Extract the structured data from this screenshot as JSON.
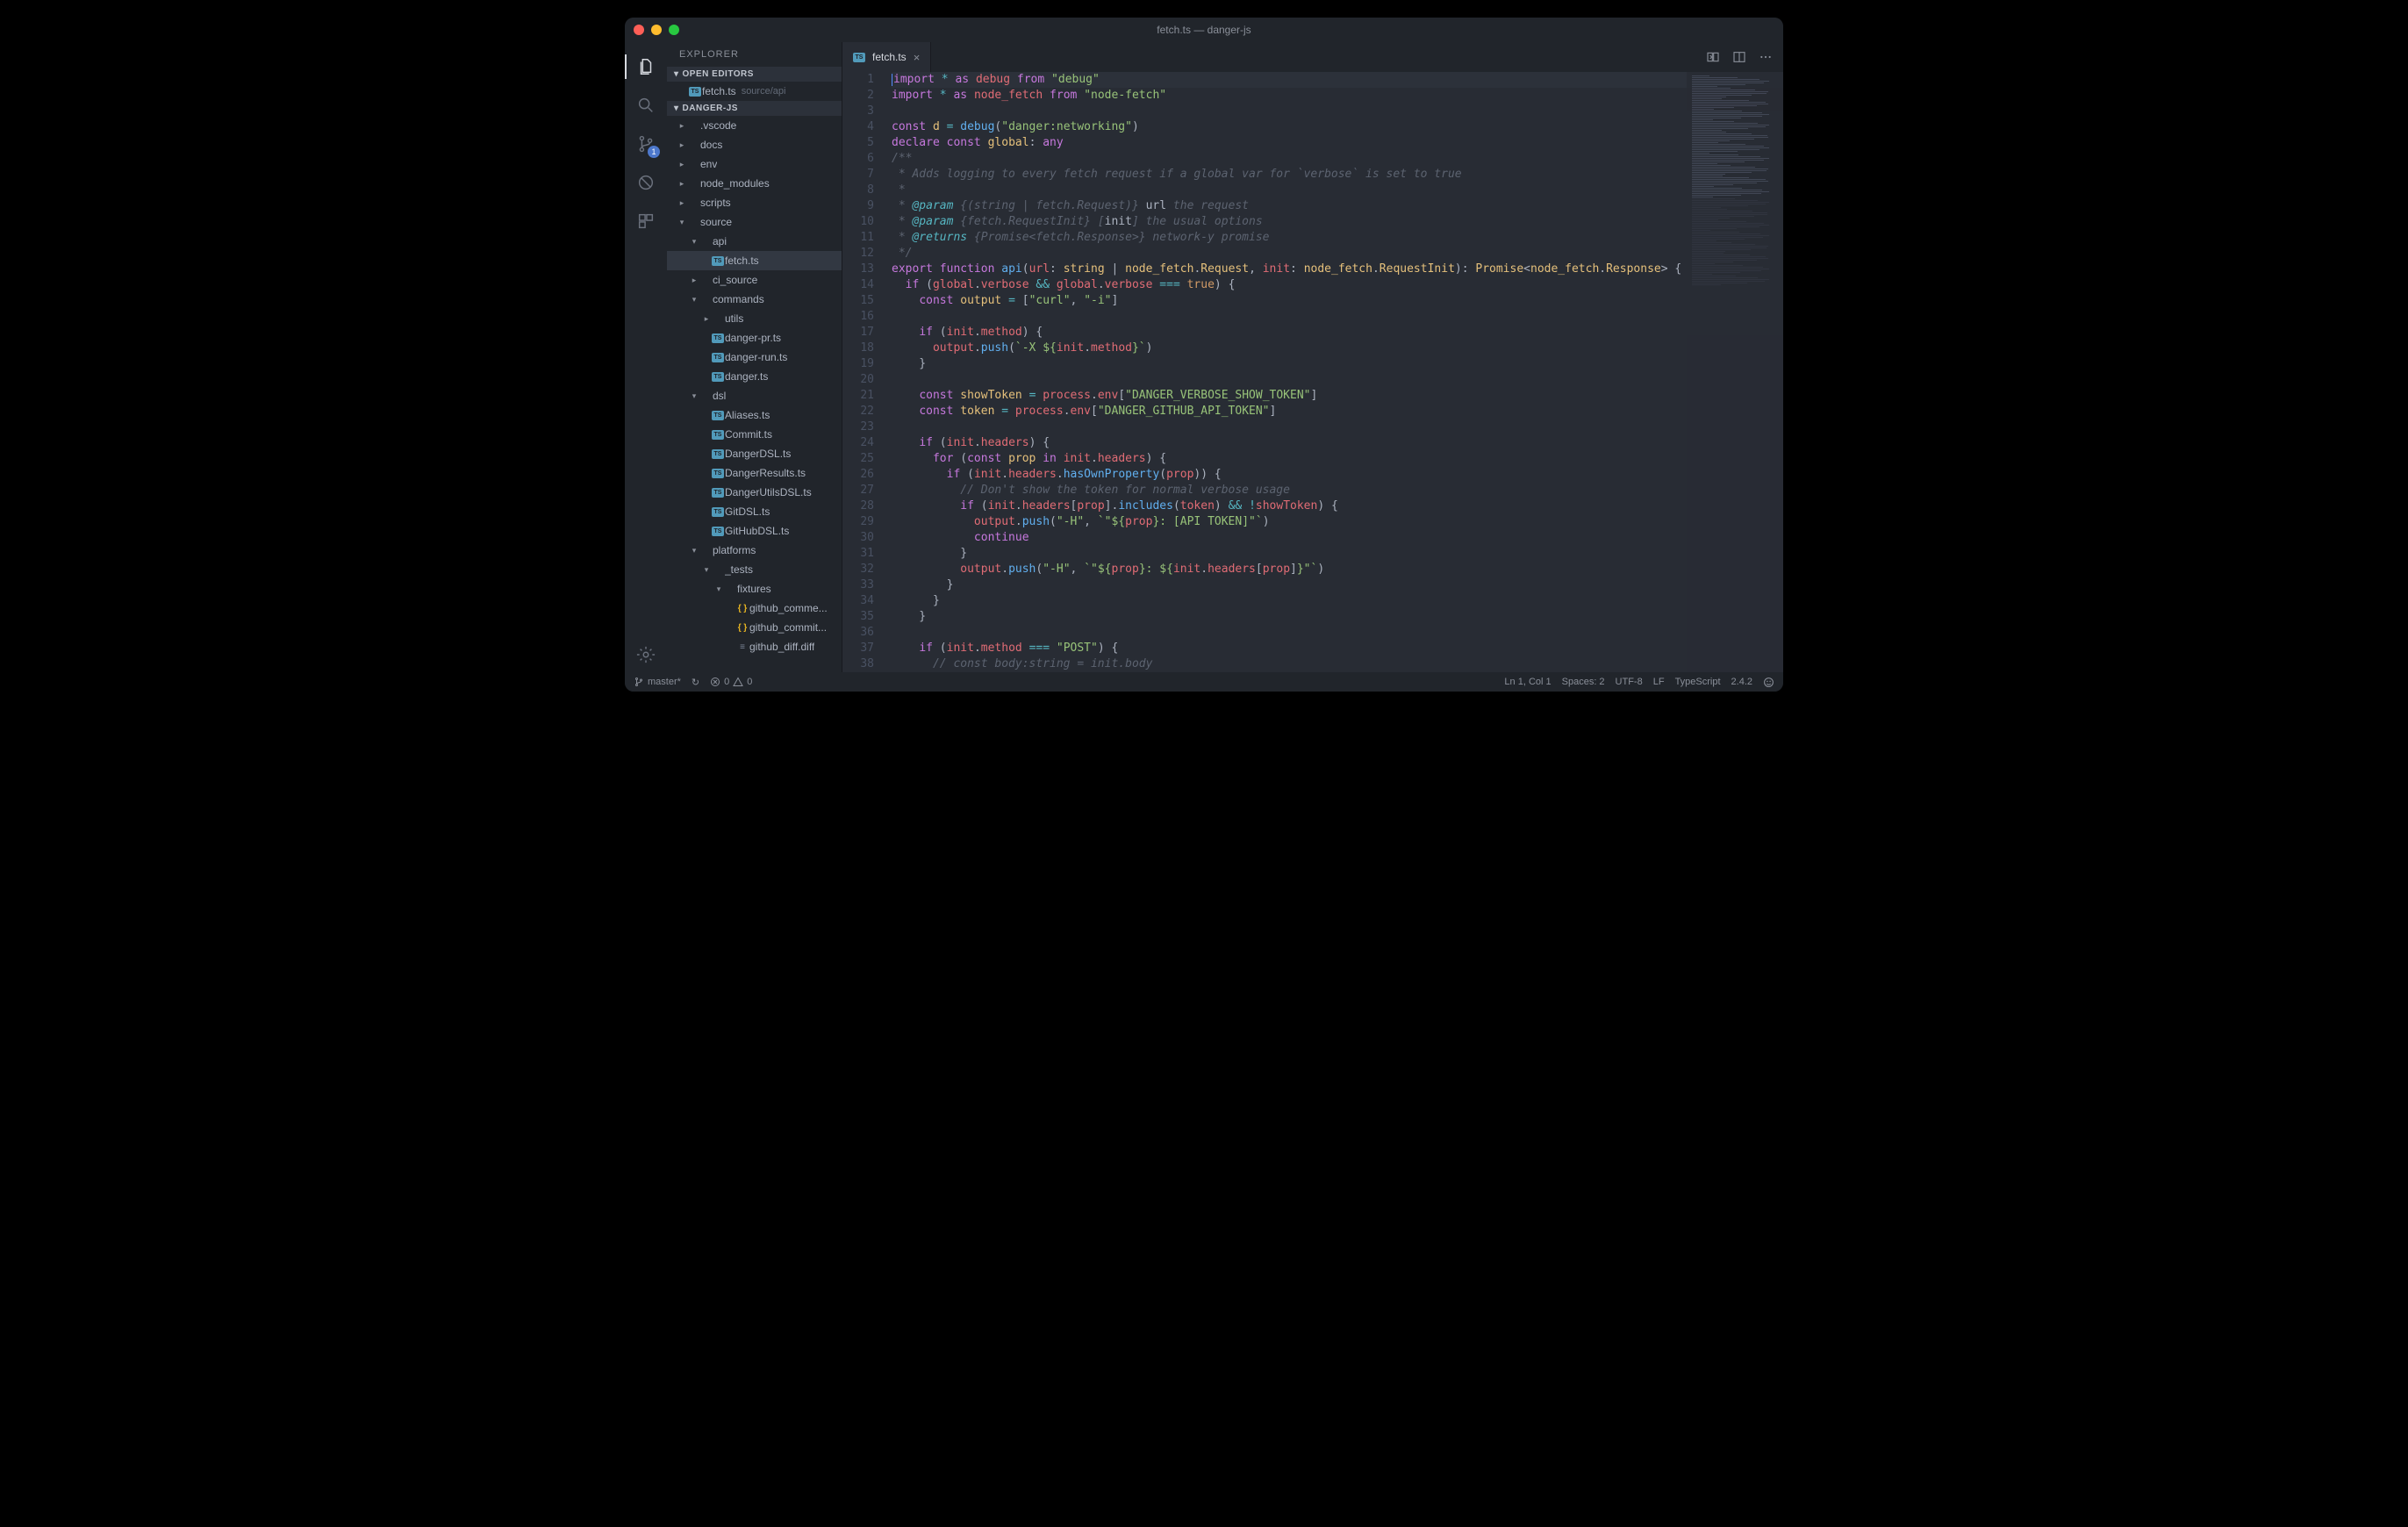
{
  "window": {
    "title": "fetch.ts — danger-js"
  },
  "activitybar": {
    "badge": "1"
  },
  "sidebar": {
    "title": "EXPLORER",
    "sections": {
      "open_editors": "OPEN EDITORS",
      "project": "DANGER-JS"
    },
    "open_editors": [
      {
        "icon": "ts",
        "name": "fetch.ts",
        "desc": "source/api"
      }
    ],
    "tree": [
      {
        "depth": 0,
        "chev": "right",
        "icon": "",
        "label": ".vscode"
      },
      {
        "depth": 0,
        "chev": "right",
        "icon": "",
        "label": "docs"
      },
      {
        "depth": 0,
        "chev": "right",
        "icon": "",
        "label": "env"
      },
      {
        "depth": 0,
        "chev": "right",
        "icon": "",
        "label": "node_modules"
      },
      {
        "depth": 0,
        "chev": "right",
        "icon": "",
        "label": "scripts"
      },
      {
        "depth": 0,
        "chev": "down",
        "icon": "",
        "label": "source"
      },
      {
        "depth": 1,
        "chev": "down",
        "icon": "",
        "label": "api"
      },
      {
        "depth": 2,
        "chev": "",
        "icon": "ts",
        "label": "fetch.ts",
        "selected": true
      },
      {
        "depth": 1,
        "chev": "right",
        "icon": "",
        "label": "ci_source"
      },
      {
        "depth": 1,
        "chev": "down",
        "icon": "",
        "label": "commands"
      },
      {
        "depth": 2,
        "chev": "right",
        "icon": "",
        "label": "utils"
      },
      {
        "depth": 2,
        "chev": "",
        "icon": "ts",
        "label": "danger-pr.ts"
      },
      {
        "depth": 2,
        "chev": "",
        "icon": "ts",
        "label": "danger-run.ts"
      },
      {
        "depth": 2,
        "chev": "",
        "icon": "ts",
        "label": "danger.ts"
      },
      {
        "depth": 1,
        "chev": "down",
        "icon": "",
        "label": "dsl"
      },
      {
        "depth": 2,
        "chev": "",
        "icon": "ts",
        "label": "Aliases.ts"
      },
      {
        "depth": 2,
        "chev": "",
        "icon": "ts",
        "label": "Commit.ts"
      },
      {
        "depth": 2,
        "chev": "",
        "icon": "ts",
        "label": "DangerDSL.ts"
      },
      {
        "depth": 2,
        "chev": "",
        "icon": "ts",
        "label": "DangerResults.ts"
      },
      {
        "depth": 2,
        "chev": "",
        "icon": "ts",
        "label": "DangerUtilsDSL.ts"
      },
      {
        "depth": 2,
        "chev": "",
        "icon": "ts",
        "label": "GitDSL.ts"
      },
      {
        "depth": 2,
        "chev": "",
        "icon": "ts",
        "label": "GitHubDSL.ts"
      },
      {
        "depth": 1,
        "chev": "down",
        "icon": "",
        "label": "platforms"
      },
      {
        "depth": 2,
        "chev": "down",
        "icon": "",
        "label": "_tests"
      },
      {
        "depth": 3,
        "chev": "down",
        "icon": "",
        "label": "fixtures"
      },
      {
        "depth": 4,
        "chev": "",
        "icon": "braces",
        "label": "github_comme..."
      },
      {
        "depth": 4,
        "chev": "",
        "icon": "braces",
        "label": "github_commit..."
      },
      {
        "depth": 4,
        "chev": "",
        "icon": "lines",
        "label": "github_diff.diff"
      }
    ]
  },
  "tab": {
    "icon": "ts",
    "name": "fetch.ts"
  },
  "editor": {
    "lines": [
      {
        "n": 1,
        "html": "<span class='k-import'>import</span> <span class='k-star'>*</span> <span class='k-import'>as</span> <span class='k-ident'>debug</span> <span class='k-import'>from</span> <span class='k-string'>\"debug\"</span>",
        "hl": true,
        "cursor": true
      },
      {
        "n": 2,
        "html": "<span class='k-import'>import</span> <span class='k-star'>*</span> <span class='k-import'>as</span> <span class='k-ident'>node_fetch</span> <span class='k-import'>from</span> <span class='k-string'>\"node-fetch\"</span>"
      },
      {
        "n": 3,
        "html": ""
      },
      {
        "n": 4,
        "html": "<span class='k-keyword'>const</span> <span class='k-type'>d</span> <span class='k-op'>=</span> <span class='k-func'>debug</span>(<span class='k-string'>\"danger:networking\"</span>)"
      },
      {
        "n": 5,
        "html": "<span class='k-keyword'>declare</span> <span class='k-keyword'>const</span> <span class='k-type'>global</span>: <span class='k-keyword'>any</span>"
      },
      {
        "n": 6,
        "html": "<span class='k-comment'>/**</span>"
      },
      {
        "n": 7,
        "html": "<span class='k-comment'> * Adds logging to every fetch request if a global var for `verbose` is set to true</span>"
      },
      {
        "n": 8,
        "html": "<span class='k-comment'> *</span>"
      },
      {
        "n": 9,
        "html": "<span class='k-comment'> * <span class='k-tag'>@param</span> {(string | fetch.Request)} </span><span class='k-default'>url</span><span class='k-comment'> the request</span>"
      },
      {
        "n": 10,
        "html": "<span class='k-comment'> * <span class='k-tag'>@param</span> {fetch.RequestInit} [</span><span class='k-default'>init</span><span class='k-comment'>] the usual options</span>"
      },
      {
        "n": 11,
        "html": "<span class='k-comment'> * <span class='k-tag'>@returns</span> {Promise&lt;fetch.Response&gt;} network-y promise</span>"
      },
      {
        "n": 12,
        "html": "<span class='k-comment'> */</span>"
      },
      {
        "n": 13,
        "html": "<span class='k-keyword'>export</span> <span class='k-keyword'>function</span> <span class='k-func'>api</span>(<span class='k-ident'>url</span>: <span class='k-type'>string</span> | <span class='k-type'>node_fetch</span>.<span class='k-type'>Request</span>, <span class='k-ident'>init</span>: <span class='k-type'>node_fetch</span>.<span class='k-type'>RequestInit</span>): <span class='k-type'>Promise</span>&lt;<span class='k-type'>node_fetch</span>.<span class='k-type'>Response</span>&gt; {"
      },
      {
        "n": 14,
        "html": "  <span class='k-keyword'>if</span> (<span class='k-ident'>global</span>.<span class='k-prop'>verbose</span> <span class='k-op'>&amp;&amp;</span> <span class='k-ident'>global</span>.<span class='k-prop'>verbose</span> <span class='k-op'>===</span> <span class='k-const'>true</span>) {"
      },
      {
        "n": 15,
        "html": "    <span class='k-keyword'>const</span> <span class='k-type'>output</span> <span class='k-op'>=</span> [<span class='k-string'>\"curl\"</span>, <span class='k-string'>\"-i\"</span>]"
      },
      {
        "n": 16,
        "html": ""
      },
      {
        "n": 17,
        "html": "    <span class='k-keyword'>if</span> (<span class='k-ident'>init</span>.<span class='k-prop'>method</span>) {"
      },
      {
        "n": 18,
        "html": "      <span class='k-ident'>output</span>.<span class='k-func'>push</span>(<span class='k-string'>`-X ${</span><span class='k-ident'>init</span>.<span class='k-prop'>method</span><span class='k-string'>}`</span>)"
      },
      {
        "n": 19,
        "html": "    }"
      },
      {
        "n": 20,
        "html": ""
      },
      {
        "n": 21,
        "html": "    <span class='k-keyword'>const</span> <span class='k-type'>showToken</span> <span class='k-op'>=</span> <span class='k-ident'>process</span>.<span class='k-prop'>env</span>[<span class='k-string'>\"DANGER_VERBOSE_SHOW_TOKEN\"</span>]"
      },
      {
        "n": 22,
        "html": "    <span class='k-keyword'>const</span> <span class='k-type'>token</span> <span class='k-op'>=</span> <span class='k-ident'>process</span>.<span class='k-prop'>env</span>[<span class='k-string'>\"DANGER_GITHUB_API_TOKEN\"</span>]"
      },
      {
        "n": 23,
        "html": ""
      },
      {
        "n": 24,
        "html": "    <span class='k-keyword'>if</span> (<span class='k-ident'>init</span>.<span class='k-prop'>headers</span>) {"
      },
      {
        "n": 25,
        "html": "      <span class='k-keyword'>for</span> (<span class='k-keyword'>const</span> <span class='k-type'>prop</span> <span class='k-keyword'>in</span> <span class='k-ident'>init</span>.<span class='k-prop'>headers</span>) {"
      },
      {
        "n": 26,
        "html": "        <span class='k-keyword'>if</span> (<span class='k-ident'>init</span>.<span class='k-prop'>headers</span>.<span class='k-func'>hasOwnProperty</span>(<span class='k-ident'>prop</span>)) {"
      },
      {
        "n": 27,
        "html": "          <span class='k-comment'>// Don't show the token for normal verbose usage</span>"
      },
      {
        "n": 28,
        "html": "          <span class='k-keyword'>if</span> (<span class='k-ident'>init</span>.<span class='k-prop'>headers</span>[<span class='k-ident'>prop</span>].<span class='k-func'>includes</span>(<span class='k-ident'>token</span>) <span class='k-op'>&amp;&amp;</span> <span class='k-op'>!</span><span class='k-ident'>showToken</span>) {"
      },
      {
        "n": 29,
        "html": "            <span class='k-ident'>output</span>.<span class='k-func'>push</span>(<span class='k-string'>\"-H\"</span>, <span class='k-string'>`\"${</span><span class='k-ident'>prop</span><span class='k-string'>}: [API TOKEN]\"`</span>)"
      },
      {
        "n": 30,
        "html": "            <span class='k-keyword'>continue</span>"
      },
      {
        "n": 31,
        "html": "          }"
      },
      {
        "n": 32,
        "html": "          <span class='k-ident'>output</span>.<span class='k-func'>push</span>(<span class='k-string'>\"-H\"</span>, <span class='k-string'>`\"${</span><span class='k-ident'>prop</span><span class='k-string'>}: ${</span><span class='k-ident'>init</span>.<span class='k-prop'>headers</span>[<span class='k-ident'>prop</span>]<span class='k-string'>}\"`</span>)"
      },
      {
        "n": 33,
        "html": "        }"
      },
      {
        "n": 34,
        "html": "      }"
      },
      {
        "n": 35,
        "html": "    }"
      },
      {
        "n": 36,
        "html": ""
      },
      {
        "n": 37,
        "html": "    <span class='k-keyword'>if</span> (<span class='k-ident'>init</span>.<span class='k-prop'>method</span> <span class='k-op'>===</span> <span class='k-string'>\"POST\"</span>) {"
      },
      {
        "n": 38,
        "html": "      <span class='k-comment'>// const body:string = init.body</span>"
      }
    ]
  },
  "status": {
    "branch": "master*",
    "sync": "↻",
    "errors": "0",
    "warnings": "0",
    "position": "Ln 1, Col 1",
    "spaces": "Spaces: 2",
    "encoding": "UTF-8",
    "eol": "LF",
    "language": "TypeScript",
    "version": "2.4.2"
  }
}
